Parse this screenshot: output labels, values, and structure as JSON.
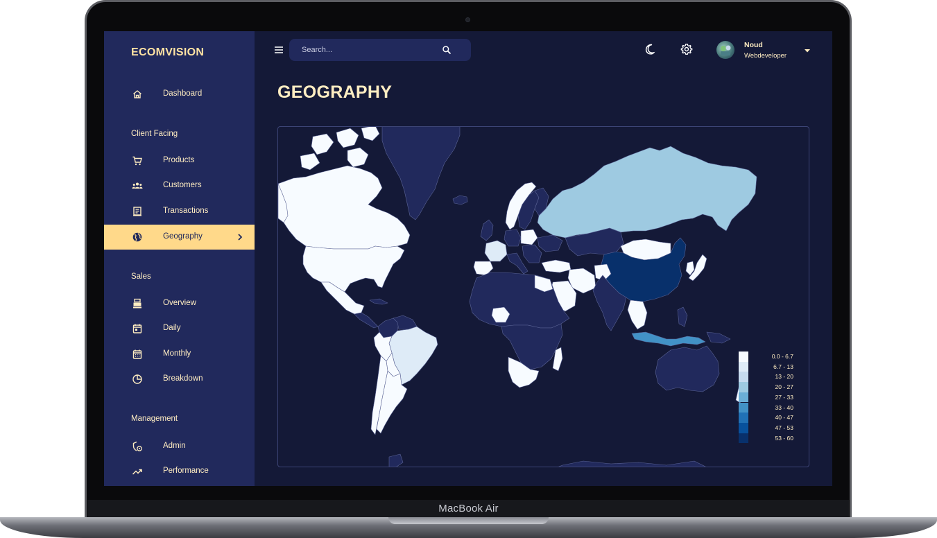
{
  "brand": "ECOMVISION",
  "search": {
    "placeholder": "Search..."
  },
  "user": {
    "name": "Noud",
    "role": "Webdeveloper"
  },
  "page_title": "GEOGRAPHY",
  "nav": {
    "dashboard": "Dashboard",
    "section_client": "Client Facing",
    "products": "Products",
    "customers": "Customers",
    "transactions": "Transactions",
    "geography": "Geography",
    "section_sales": "Sales",
    "overview": "Overview",
    "daily": "Daily",
    "monthly": "Monthly",
    "breakdown": "Breakdown",
    "section_management": "Management",
    "admin": "Admin",
    "performance": "Performance"
  },
  "legend": {
    "items": [
      "0.0 - 6.7",
      "6.7 - 13",
      "13 - 20",
      "20 - 27",
      "27 - 33",
      "33 - 40",
      "40 - 47",
      "47 - 53",
      "53 - 60"
    ],
    "colors": [
      "#f7fbff",
      "#deebf7",
      "#c6dbef",
      "#9ecae1",
      "#6baed6",
      "#4292c6",
      "#2171b5",
      "#08519c",
      "#08306b"
    ]
  },
  "device_label": "MacBook Air",
  "colors": {
    "sidebar_bg": "#21295c",
    "main_bg": "#141937",
    "accent": "#ffd98a",
    "text": "#ffedc2",
    "land_default": "#21295c"
  },
  "active_nav": "geography"
}
